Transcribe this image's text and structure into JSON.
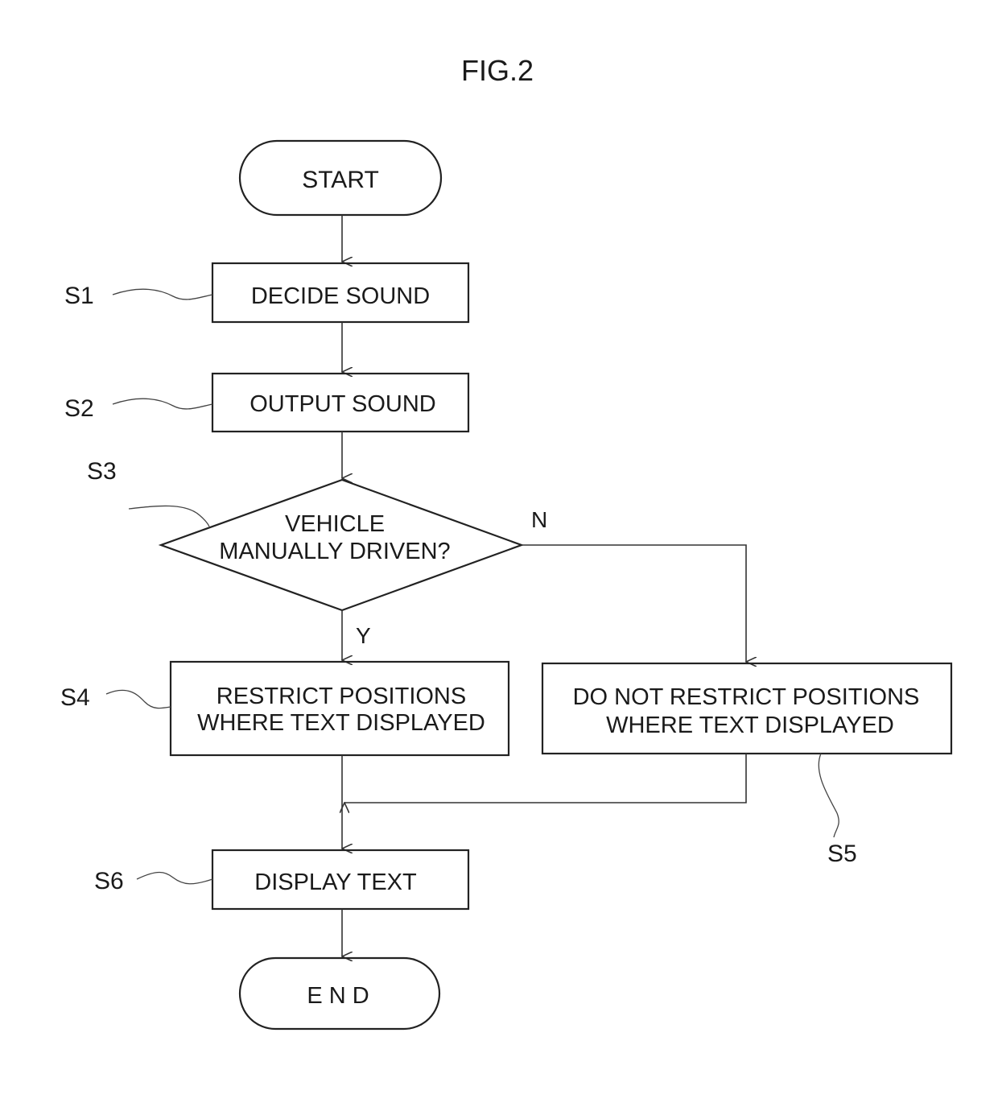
{
  "figure": {
    "title": "FIG.2"
  },
  "nodes": {
    "start": {
      "label": "START"
    },
    "s1": {
      "step": "S1",
      "label": "DECIDE SOUND"
    },
    "s2": {
      "step": "S2",
      "label": "OUTPUT SOUND"
    },
    "s3": {
      "step": "S3",
      "line1": "VEHICLE",
      "line2": "MANUALLY DRIVEN?"
    },
    "s4": {
      "step": "S4",
      "line1": "RESTRICT POSITIONS",
      "line2": "WHERE TEXT DISPLAYED"
    },
    "s5": {
      "step": "S5",
      "line1": "DO NOT RESTRICT POSITIONS",
      "line2": "WHERE TEXT DISPLAYED"
    },
    "s6": {
      "step": "S6",
      "label": "DISPLAY TEXT"
    },
    "end": {
      "label": "E N D"
    }
  },
  "branches": {
    "yes": "Y",
    "no": "N"
  }
}
